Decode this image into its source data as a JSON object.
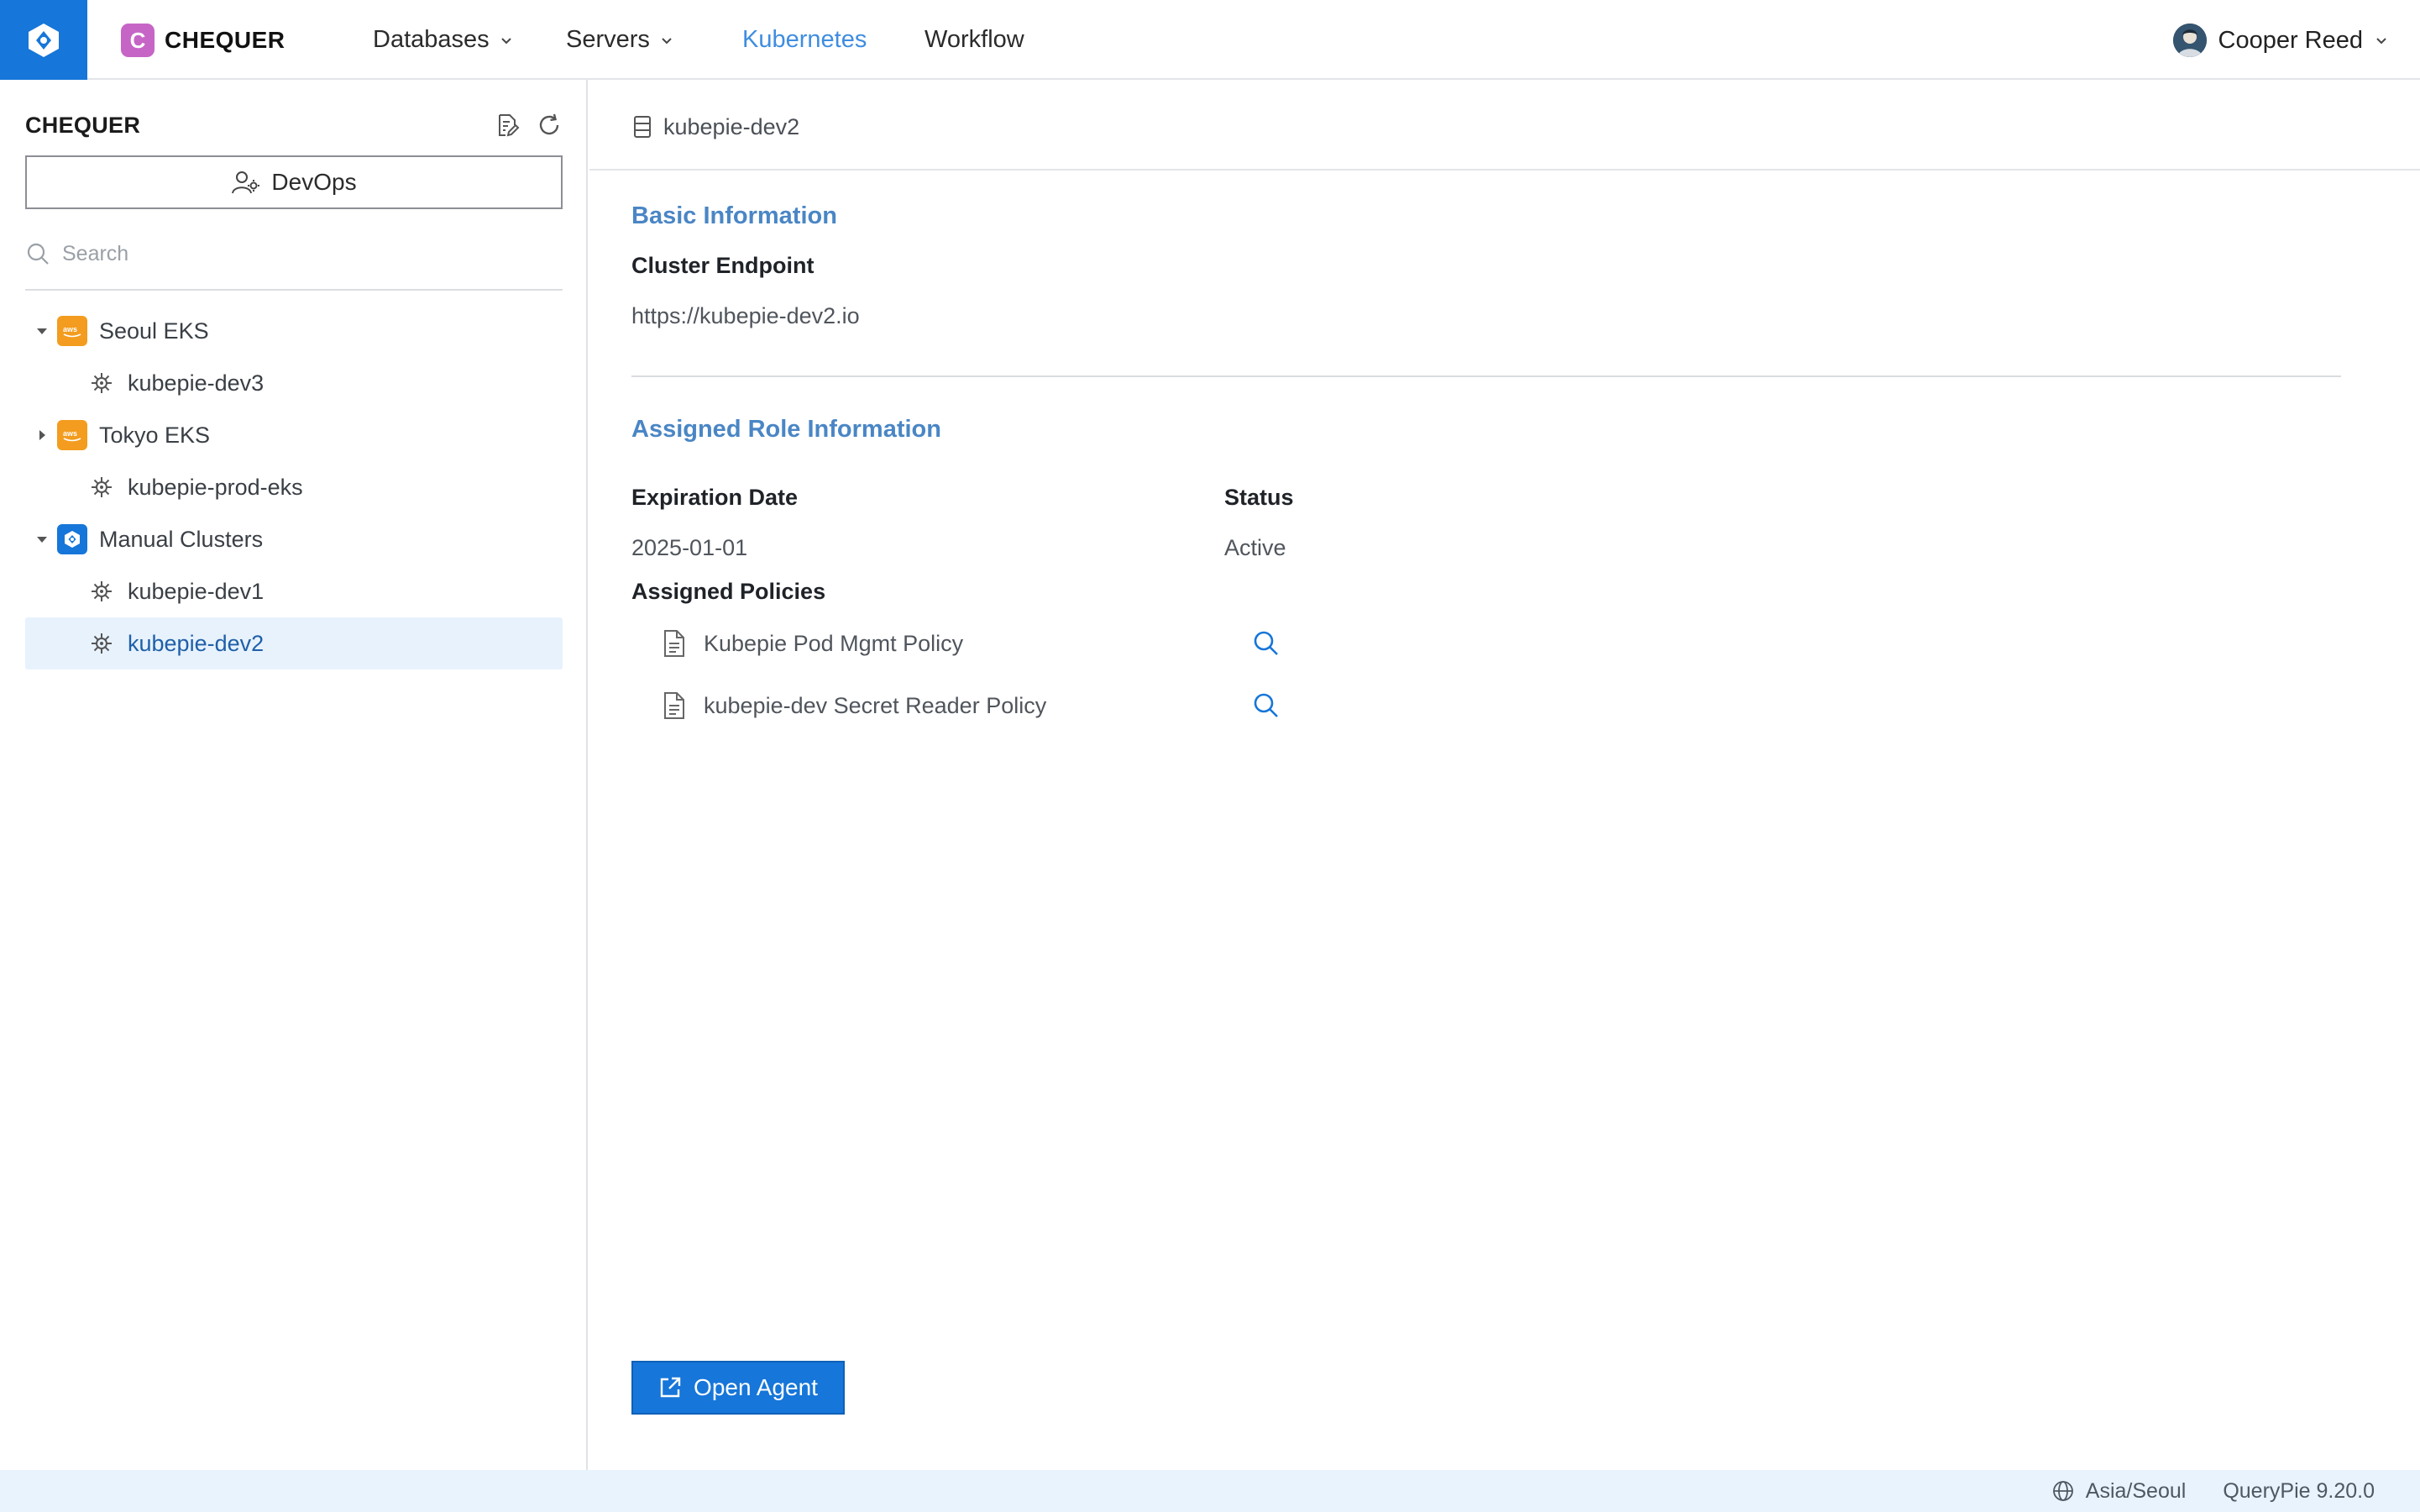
{
  "topbar": {
    "brand_badge": "C",
    "brand_name": "CHEQUER",
    "nav": [
      {
        "label": "Databases",
        "dropdown": true,
        "active": false
      },
      {
        "label": "Servers",
        "dropdown": true,
        "active": false
      },
      {
        "label": "Kubernetes",
        "dropdown": false,
        "active": true
      },
      {
        "label": "Workflow",
        "dropdown": false,
        "active": false
      }
    ],
    "user_name": "Cooper Reed"
  },
  "sidebar": {
    "title": "CHEQUER",
    "role_button": "DevOps",
    "search_placeholder": "Search",
    "tree": [
      {
        "label": "Seoul EKS",
        "type": "group",
        "provider_icon": "aws-icon",
        "expanded": true,
        "children": [
          {
            "label": "kubepie-dev3",
            "icon": "kubernetes-icon"
          }
        ]
      },
      {
        "label": "Tokyo EKS",
        "type": "group",
        "provider_icon": "aws-icon",
        "expanded": false,
        "children": [
          {
            "label": "kubepie-prod-eks",
            "icon": "kubernetes-icon"
          }
        ]
      },
      {
        "label": "Manual Clusters",
        "type": "group",
        "provider_icon": "querypie-icon",
        "expanded": true,
        "children": [
          {
            "label": "kubepie-dev1",
            "icon": "kubernetes-icon"
          },
          {
            "label": "kubepie-dev2",
            "icon": "kubernetes-icon",
            "selected": true
          }
        ]
      }
    ]
  },
  "main": {
    "breadcrumb": "kubepie-dev2",
    "basic_info": {
      "title": "Basic Information",
      "endpoint_label": "Cluster Endpoint",
      "endpoint_value": "https://kubepie-dev2.io"
    },
    "role_info": {
      "title": "Assigned Role Information",
      "expiration_label": "Expiration Date",
      "expiration_value": "2025-01-01",
      "status_label": "Status",
      "status_value": "Active",
      "policies_label": "Assigned Policies",
      "policies": [
        "Kubepie Pod Mgmt Policy",
        "kubepie-dev Secret Reader Policy"
      ]
    },
    "open_agent_label": "Open Agent"
  },
  "footer": {
    "timezone": "Asia/Seoul",
    "version": "QueryPie 9.20.0"
  },
  "colors": {
    "brand_blue": "#1676d9",
    "section_title": "#4a86c5",
    "active_nav": "#3f8de0",
    "aws_orange": "#f39c1f",
    "badge_purple": "#c665c6",
    "selected_row": "#e7f2fd",
    "footer_bg": "#e8f3fd"
  }
}
